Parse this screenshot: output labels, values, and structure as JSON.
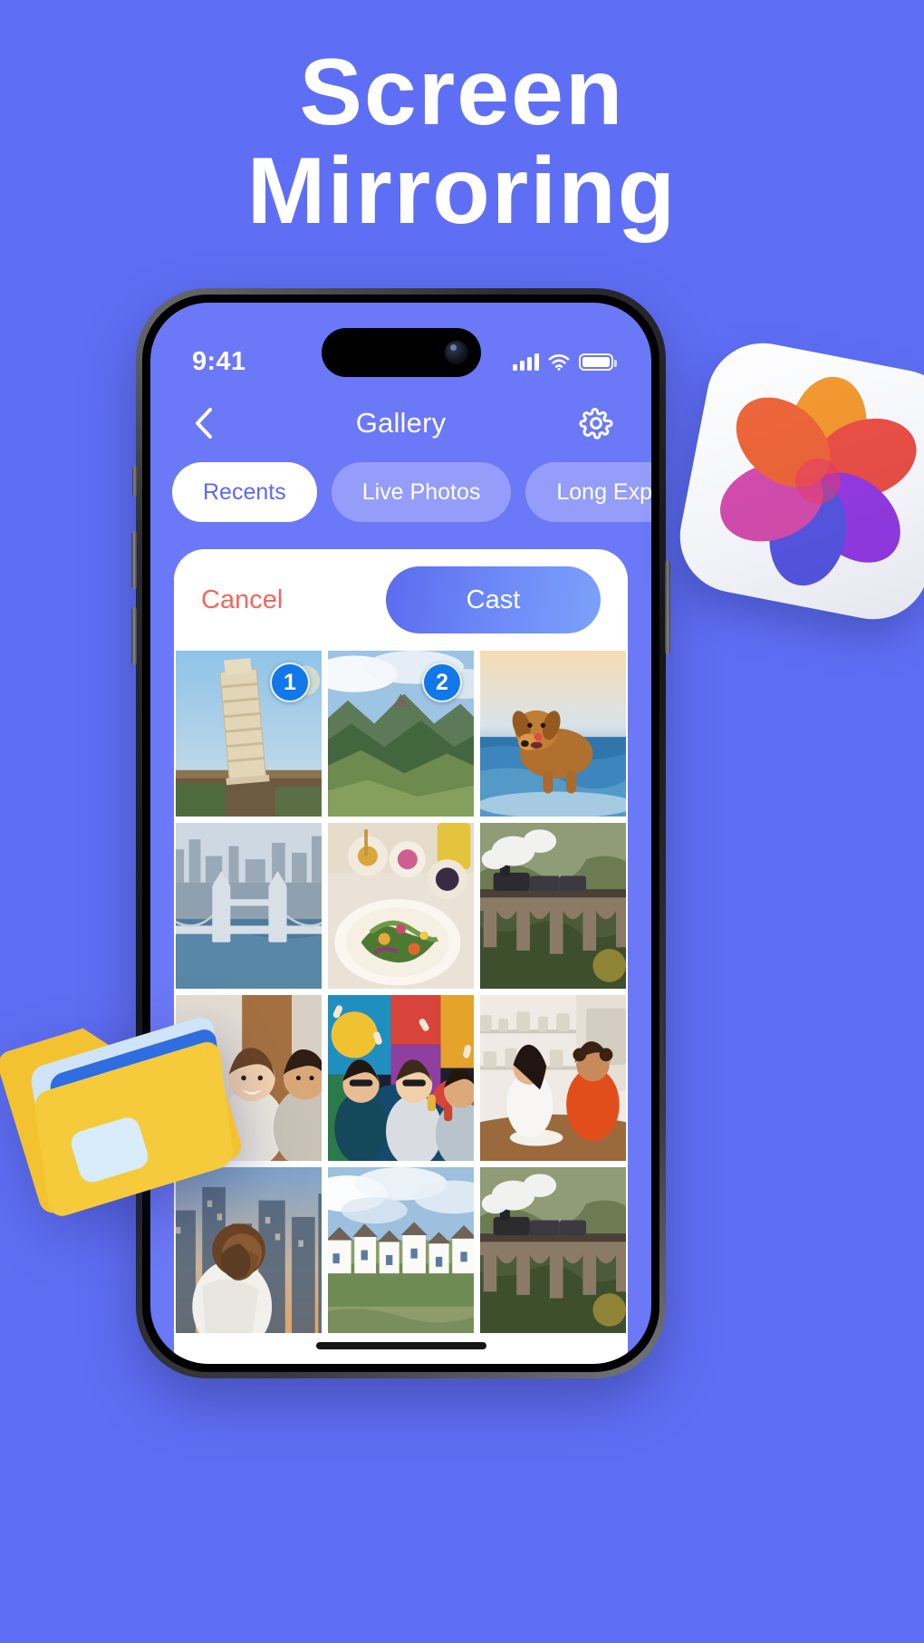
{
  "page": {
    "background_color": "#5f6ff5",
    "headline_line1": "Screen",
    "headline_line2": "Mirroring"
  },
  "phone": {
    "status_bar": {
      "time": "9:41",
      "signal_icon": "cellular-signal-icon",
      "wifi_icon": "wifi-icon",
      "battery_icon": "battery-icon"
    },
    "nav": {
      "back_icon": "chevron-left-icon",
      "title": "Gallery",
      "settings_icon": "gear-icon"
    },
    "chips": [
      {
        "label": "Recents",
        "active": true
      },
      {
        "label": "Live Photos",
        "active": false
      },
      {
        "label": "Long Exposure",
        "active": false
      }
    ],
    "sheet": {
      "cancel_label": "Cancel",
      "cast_label": "Cast",
      "cancel_color": "#f4655f",
      "cast_color": "#5b6bef"
    },
    "grid": {
      "columns": 3,
      "photos": [
        {
          "id": "p1",
          "alt": "Leaning Tower of Pisa",
          "badge": "1"
        },
        {
          "id": "p2",
          "alt": "Green mountain valley",
          "badge": "2"
        },
        {
          "id": "p3",
          "alt": "Dog running on beach",
          "badge": null
        },
        {
          "id": "p4",
          "alt": "Tower Bridge London",
          "badge": null
        },
        {
          "id": "p5",
          "alt": "Salad and food table",
          "badge": null
        },
        {
          "id": "p6",
          "alt": "Steam train on viaduct",
          "badge": null
        },
        {
          "id": "p7",
          "alt": "Friends laughing indoors",
          "badge": null
        },
        {
          "id": "p8",
          "alt": "Party with confetti mural",
          "badge": null
        },
        {
          "id": "p9",
          "alt": "Two women in kitchen",
          "badge": null
        },
        {
          "id": "p10",
          "alt": "Woman in city at sunset",
          "badge": null
        },
        {
          "id": "p11",
          "alt": "Coastal white houses",
          "badge": null
        },
        {
          "id": "p12",
          "alt": "Steam train on viaduct",
          "badge": null
        }
      ]
    },
    "home_indicator": "home-indicator"
  },
  "decorations": {
    "photos_app_icon": "photos-app-icon",
    "folders_icon": "folders-3d-icon"
  }
}
